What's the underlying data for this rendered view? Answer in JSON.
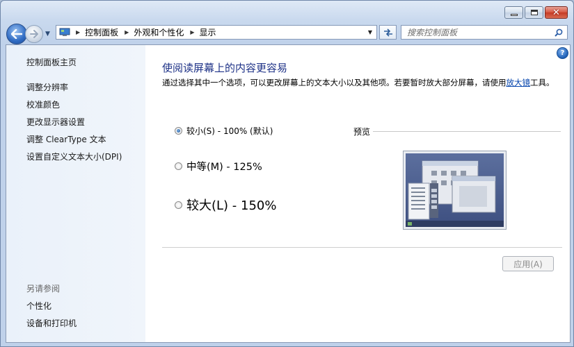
{
  "window": {
    "caption_buttons": {
      "minimize": "minimize-icon",
      "maximize": "maximize-icon",
      "close": "close-icon"
    }
  },
  "nav": {
    "breadcrumbs": [
      "控制面板",
      "外观和个性化",
      "显示"
    ],
    "search_placeholder": "搜索控制面板"
  },
  "sidebar": {
    "items": [
      "控制面板主页",
      "调整分辨率",
      "校准颜色",
      "更改显示器设置",
      "调整 ClearType 文本",
      "设置自定义文本大小(DPI)"
    ],
    "see_also_label": "另请参阅",
    "see_also_items": [
      "个性化",
      "设备和打印机"
    ]
  },
  "main": {
    "title": "使阅读屏幕上的内容更容易",
    "description_before": "通过选择其中一个选项，可以更改屏幕上的文本大小以及其他项。若要暂时放大部分屏幕，请使用",
    "description_link": "放大镜",
    "description_after": "工具。",
    "options": [
      {
        "label": "较小(S) - 100% (默认)",
        "selected": true
      },
      {
        "label": "中等(M) - 125%",
        "selected": false
      },
      {
        "label": "较大(L) - 150%",
        "selected": false
      }
    ],
    "preview_label": "预览",
    "apply_label": "应用(A)",
    "apply_enabled": false
  },
  "colors": {
    "title": "#1e3287",
    "link": "#0645ad",
    "accent": "#2f6bc3"
  }
}
